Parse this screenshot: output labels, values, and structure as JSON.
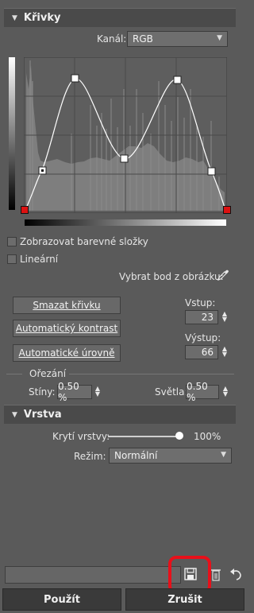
{
  "curves": {
    "title": "Křivky",
    "channel_label": "Kanál:",
    "channel_value": "RGB",
    "show_color_components": "Zobrazovat barevné složky",
    "linear": "Lineární",
    "pick_point_label": "Vybrat bod z obrázku:",
    "delete_curve": "Smazat křivku",
    "auto_contrast": "Automatický kontrast",
    "auto_levels": "Automatické úrovně",
    "input_label": "Vstup:",
    "input_value": "23",
    "output_label": "Výstup:",
    "output_value": "66"
  },
  "clipping": {
    "title": "Ořezání",
    "shadows_label": "Stíny:",
    "shadows_value": "0.50 %",
    "highlights_label": "Světla:",
    "highlights_value": "0.50 %"
  },
  "layer": {
    "title": "Vrstva",
    "opacity_label": "Krytí vrstvy:",
    "opacity_value": "100%",
    "opacity_level": 1.0,
    "mode_label": "Režim:",
    "mode_value": "Normální"
  },
  "footer": {
    "apply": "Použít",
    "cancel": "Zrušit"
  },
  "colors": {
    "highlight": "#e8101a",
    "endpoint": "#dd1111"
  }
}
